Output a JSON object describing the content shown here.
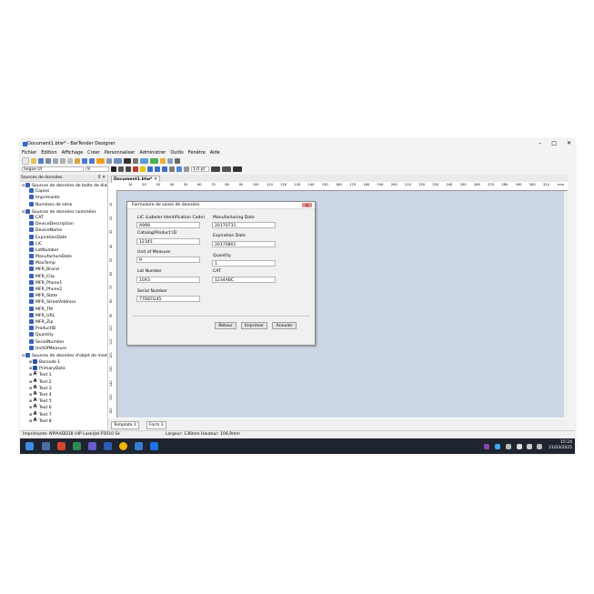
{
  "window": {
    "title": "Document1.btw* - BarTender Designer",
    "minimize": "–",
    "maximize": "□",
    "close": "✕"
  },
  "menu": [
    "Fichier",
    "Edition",
    "Affichage",
    "Créer",
    "Personnaliser",
    "Administrer",
    "Outils",
    "Fenêtre",
    "Aide"
  ],
  "format_bar": {
    "font": "Segoe UI",
    "size": "9",
    "line_width": "1,0 pt"
  },
  "left_panel": {
    "title": "Sources de données",
    "items": [
      {
        "label": "Sources de données de boîte de dial",
        "level": 0,
        "expand": "⊟",
        "icon": "folder-icon"
      },
      {
        "label": "Copies",
        "level": 1,
        "icon": "field-icon"
      },
      {
        "label": "Imprimante",
        "level": 1,
        "icon": "printer-icon"
      },
      {
        "label": "Numéros de série",
        "level": 1,
        "icon": "field-icon"
      },
      {
        "label": "Sources de données nommées",
        "level": 0,
        "expand": "⊟",
        "icon": "database-icon"
      },
      {
        "label": "CAT",
        "level": 1,
        "icon": "field-icon"
      },
      {
        "label": "DeviceDescription",
        "level": 1,
        "icon": "field-icon"
      },
      {
        "label": "DeviceName",
        "level": 1,
        "icon": "field-icon"
      },
      {
        "label": "ExpirationDate",
        "level": 1,
        "icon": "field-icon"
      },
      {
        "label": "LIC",
        "level": 1,
        "icon": "field-icon"
      },
      {
        "label": "LotNumber",
        "level": 1,
        "icon": "field-icon"
      },
      {
        "label": "ManufactureDate",
        "level": 1,
        "icon": "field-icon"
      },
      {
        "label": "MaxTemp",
        "level": 1,
        "icon": "field-icon"
      },
      {
        "label": "MFR_Brand",
        "level": 1,
        "icon": "field-icon"
      },
      {
        "label": "MFR_City",
        "level": 1,
        "icon": "field-icon"
      },
      {
        "label": "MFR_Phone1",
        "level": 1,
        "icon": "field-icon"
      },
      {
        "label": "MFR_Phone2",
        "level": 1,
        "icon": "field-icon"
      },
      {
        "label": "MFR_State",
        "level": 1,
        "icon": "field-icon"
      },
      {
        "label": "MFR_StreetAddress",
        "level": 1,
        "icon": "field-icon"
      },
      {
        "label": "MFR_TM",
        "level": 1,
        "icon": "field-icon"
      },
      {
        "label": "MFR_URL",
        "level": 1,
        "icon": "field-icon"
      },
      {
        "label": "MFR_Zip",
        "level": 1,
        "icon": "field-icon"
      },
      {
        "label": "ProductID",
        "level": 1,
        "icon": "field-icon"
      },
      {
        "label": "Quantity",
        "level": 1,
        "icon": "field-icon"
      },
      {
        "label": "SerialNumber",
        "level": 1,
        "icon": "field-icon"
      },
      {
        "label": "UnitOfMeasure",
        "level": 1,
        "icon": "field-icon"
      },
      {
        "label": "Sources de données d'objet de mod",
        "level": 0,
        "expand": "⊟",
        "icon": "object-icon"
      },
      {
        "label": "Barcode 1",
        "level": 1,
        "expand": "⊞",
        "icon": "barcode-icon"
      },
      {
        "label": "PrimaryData",
        "level": 1,
        "expand": "⊞",
        "icon": "barcode-icon"
      },
      {
        "label": "Text 1",
        "level": 1,
        "expand": "⊞",
        "icon": "text-icon"
      },
      {
        "label": "Text 2",
        "level": 1,
        "expand": "⊞",
        "icon": "text-icon"
      },
      {
        "label": "Text 3",
        "level": 1,
        "expand": "⊞",
        "icon": "text-icon"
      },
      {
        "label": "Text 4",
        "level": 1,
        "expand": "⊞",
        "icon": "text-icon"
      },
      {
        "label": "Text 5",
        "level": 1,
        "expand": "⊞",
        "icon": "text-icon"
      },
      {
        "label": "Text 6",
        "level": 1,
        "expand": "⊞",
        "icon": "text-icon"
      },
      {
        "label": "Text 7",
        "level": 1,
        "expand": "⊞",
        "icon": "text-icon"
      },
      {
        "label": "Text 8",
        "level": 1,
        "expand": "⊞",
        "icon": "text-icon"
      }
    ]
  },
  "document_tab": "Document1.btw*",
  "ruler": {
    "h_marks": [
      "10",
      "20",
      "30",
      "40",
      "50",
      "60",
      "70",
      "80",
      "90",
      "100",
      "110",
      "120",
      "130",
      "140",
      "150",
      "160",
      "170",
      "180",
      "190",
      "200",
      "210",
      "220",
      "230",
      "240",
      "250",
      "260",
      "270",
      "280",
      "290",
      "300",
      "310"
    ],
    "unit": "mm",
    "v_marks": [
      "10",
      "20",
      "30",
      "40",
      "50",
      "60",
      "70",
      "80",
      "90",
      "100",
      "110",
      "120",
      "130",
      "140",
      "150",
      "160"
    ]
  },
  "bottom_tabs": [
    "Template 1",
    "Form 1"
  ],
  "status": {
    "printer": "Imprimante: NPIAADD18 (HP LaserJet P3010 Se",
    "size": "Largeur: 136mm  Hauteur: 106,9mm"
  },
  "clock": {
    "time": "15:24",
    "date": "21/03/2025"
  },
  "dialog": {
    "title": "Formulaire de saisie de données",
    "close": "✕",
    "fields": [
      {
        "label": "LIC (Labeler Identification Code)",
        "value": "A999"
      },
      {
        "label": "Catalog/Product ID",
        "value": "12345"
      },
      {
        "label": "Unit of Measure",
        "value": "9"
      },
      {
        "label": "Lot Number",
        "value": "10X3"
      },
      {
        "label": "Serial Number",
        "value": "77DEFG45"
      },
      {
        "label": "Manufacturing Date",
        "value": "20170731"
      },
      {
        "label": "Expiration Date",
        "value": "20170801"
      },
      {
        "label": "Quantity",
        "value": "1"
      },
      {
        "label": "CAT",
        "value": "1234ABC"
      }
    ],
    "buttons": {
      "back": "Retour",
      "print": "Imprimer",
      "cancel": "Annuler"
    }
  },
  "colors": {
    "canvas": "#ccd6e4",
    "taskbar": "#1e2530",
    "accent": "#2b6fd6"
  }
}
